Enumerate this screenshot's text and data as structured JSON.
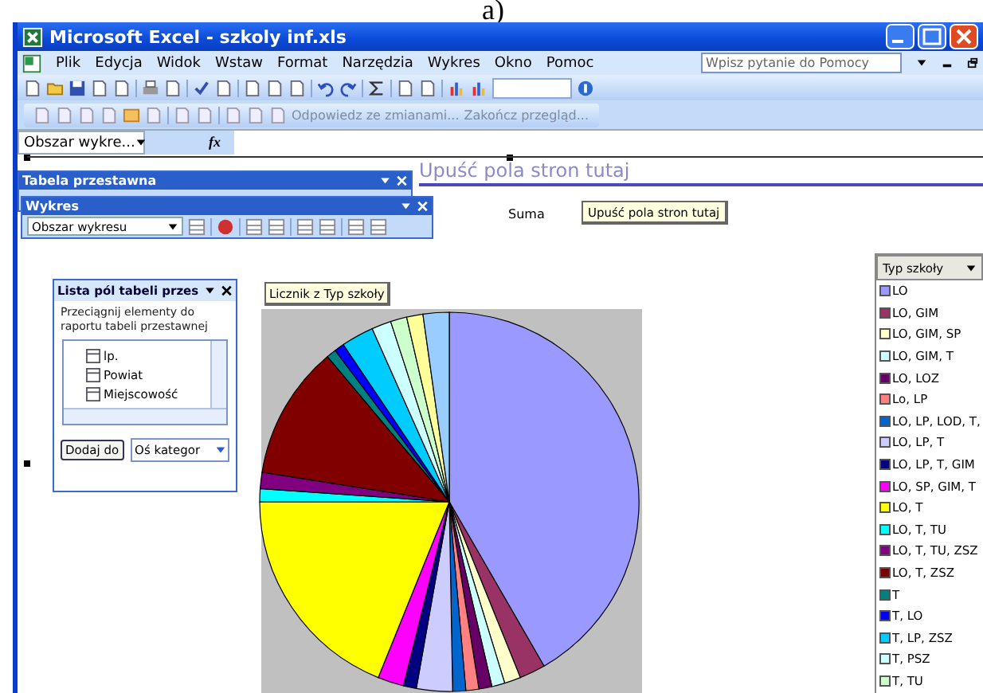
{
  "caption": "a)",
  "window": {
    "title": "Microsoft Excel - szkoly inf.xls"
  },
  "menu": [
    {
      "label": "Plik"
    },
    {
      "label": "Edycja"
    },
    {
      "label": "Widok"
    },
    {
      "label": "Wstaw"
    },
    {
      "label": "Format"
    },
    {
      "label": "Narzędzia"
    },
    {
      "label": "Wykres"
    },
    {
      "label": "Okno"
    },
    {
      "label": "Pomoc"
    }
  ],
  "help_search": {
    "placeholder": "Wpisz pytanie do Pomocy"
  },
  "review_toolbar": {
    "reply": "Odpowiedz ze zmianami...",
    "end": "Zakończ przegląd..."
  },
  "formula_bar": {
    "name_box": "Obszar wykre...",
    "fx": "fx"
  },
  "page_drop_zone": "Upuść pola stron tutaj",
  "pivot_toolbar": {
    "title": "Tabela przestawna"
  },
  "chart_toolbar": {
    "title": "Wykres",
    "object_select": "Obszar wykresu"
  },
  "data_label": "Suma",
  "page_button": "Upuść pola stron tutaj",
  "count_button": "Licznik z Typ szkoły",
  "field_list": {
    "title": "Lista pól tabeli przes",
    "hint": "Przeciągnij elementy do raportu tabeli przestawnej",
    "fields": [
      "lp.",
      "Powiat",
      "Miejscowość"
    ],
    "add_button": "Dodaj do",
    "target": "Oś kategor"
  },
  "legend": {
    "title": "Typ szkoły",
    "items": [
      {
        "label": "LO",
        "color": "#9999ff"
      },
      {
        "label": "LO, GIM",
        "color": "#993366"
      },
      {
        "label": "LO, GIM, SP",
        "color": "#ffffcc"
      },
      {
        "label": "LO, GIM, T",
        "color": "#ccffff"
      },
      {
        "label": "LO, LOZ",
        "color": "#660066"
      },
      {
        "label": "Lo, LP",
        "color": "#ff8080"
      },
      {
        "label": "LO, LP, LOD, T,",
        "color": "#0066cc"
      },
      {
        "label": "LO, LP, T",
        "color": "#ccccff"
      },
      {
        "label": "LO, LP, T, GIM",
        "color": "#000080"
      },
      {
        "label": "LO, SP, GIM, T",
        "color": "#ff00ff"
      },
      {
        "label": "LO, T",
        "color": "#ffff00"
      },
      {
        "label": "LO, T, TU",
        "color": "#00ffff"
      },
      {
        "label": "LO, T, TU, ZSZ",
        "color": "#800080"
      },
      {
        "label": "LO, T, ZSZ",
        "color": "#800000"
      },
      {
        "label": "T",
        "color": "#008080"
      },
      {
        "label": "T, LO",
        "color": "#0000ff"
      },
      {
        "label": "T, LP, ZSZ",
        "color": "#00ccff"
      },
      {
        "label": "T, PSZ",
        "color": "#ccffff"
      },
      {
        "label": "T, TU",
        "color": "#ccffcc"
      }
    ]
  }
}
